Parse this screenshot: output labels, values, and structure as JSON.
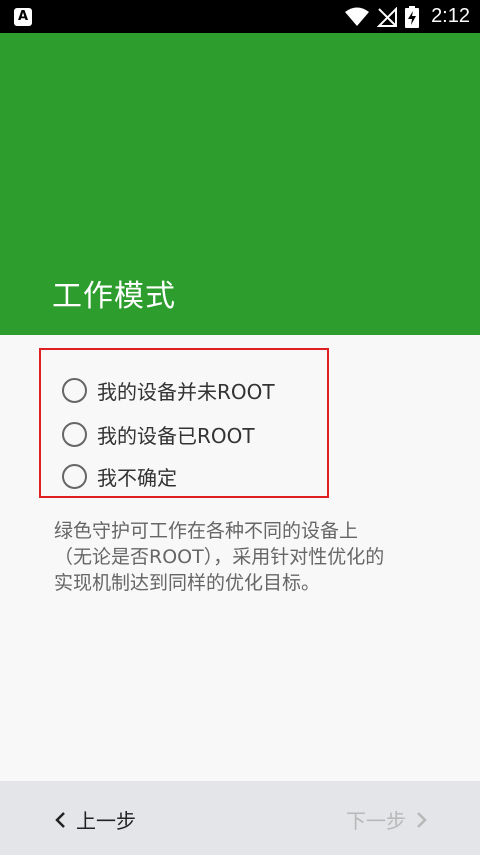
{
  "status_bar": {
    "notification_icon": "A",
    "time": "2:12",
    "icons": [
      "wifi-icon",
      "signal-icon",
      "battery-charging-icon"
    ]
  },
  "header": {
    "title": "工作模式",
    "color": "#2d9d2d"
  },
  "options": [
    {
      "label": "我的设备并未ROOT",
      "selected": false
    },
    {
      "label": "我的设备已ROOT",
      "selected": false
    },
    {
      "label": "我不确定",
      "selected": false
    }
  ],
  "description": {
    "line1": "绿色守护可工作在各种不同的设备上",
    "line2": "（无论是否ROOT），采用针对性优化的",
    "line3": "实现机制达到同样的优化目标。"
  },
  "nav": {
    "prev_label": "上一步",
    "next_label": "下一步",
    "next_enabled": false
  },
  "colors": {
    "accent_green": "#2d9d2d",
    "highlight_border": "#e02020"
  }
}
